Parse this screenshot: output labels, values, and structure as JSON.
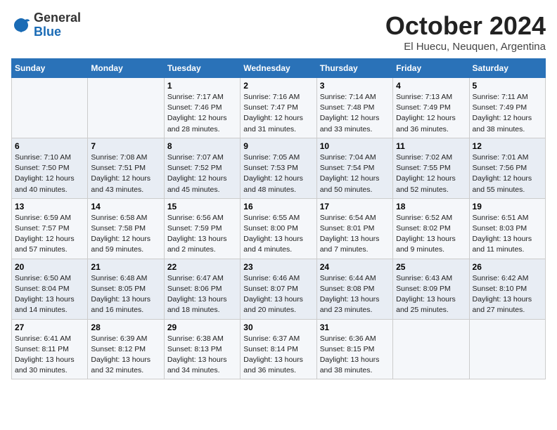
{
  "header": {
    "logo": {
      "general": "General",
      "blue": "Blue"
    },
    "title": "October 2024",
    "subtitle": "El Huecu, Neuquen, Argentina"
  },
  "days_of_week": [
    "Sunday",
    "Monday",
    "Tuesday",
    "Wednesday",
    "Thursday",
    "Friday",
    "Saturday"
  ],
  "weeks": [
    [
      {
        "day": "",
        "detail": ""
      },
      {
        "day": "",
        "detail": ""
      },
      {
        "day": "1",
        "detail": "Sunrise: 7:17 AM\nSunset: 7:46 PM\nDaylight: 12 hours\nand 28 minutes."
      },
      {
        "day": "2",
        "detail": "Sunrise: 7:16 AM\nSunset: 7:47 PM\nDaylight: 12 hours\nand 31 minutes."
      },
      {
        "day": "3",
        "detail": "Sunrise: 7:14 AM\nSunset: 7:48 PM\nDaylight: 12 hours\nand 33 minutes."
      },
      {
        "day": "4",
        "detail": "Sunrise: 7:13 AM\nSunset: 7:49 PM\nDaylight: 12 hours\nand 36 minutes."
      },
      {
        "day": "5",
        "detail": "Sunrise: 7:11 AM\nSunset: 7:49 PM\nDaylight: 12 hours\nand 38 minutes."
      }
    ],
    [
      {
        "day": "6",
        "detail": "Sunrise: 7:10 AM\nSunset: 7:50 PM\nDaylight: 12 hours\nand 40 minutes."
      },
      {
        "day": "7",
        "detail": "Sunrise: 7:08 AM\nSunset: 7:51 PM\nDaylight: 12 hours\nand 43 minutes."
      },
      {
        "day": "8",
        "detail": "Sunrise: 7:07 AM\nSunset: 7:52 PM\nDaylight: 12 hours\nand 45 minutes."
      },
      {
        "day": "9",
        "detail": "Sunrise: 7:05 AM\nSunset: 7:53 PM\nDaylight: 12 hours\nand 48 minutes."
      },
      {
        "day": "10",
        "detail": "Sunrise: 7:04 AM\nSunset: 7:54 PM\nDaylight: 12 hours\nand 50 minutes."
      },
      {
        "day": "11",
        "detail": "Sunrise: 7:02 AM\nSunset: 7:55 PM\nDaylight: 12 hours\nand 52 minutes."
      },
      {
        "day": "12",
        "detail": "Sunrise: 7:01 AM\nSunset: 7:56 PM\nDaylight: 12 hours\nand 55 minutes."
      }
    ],
    [
      {
        "day": "13",
        "detail": "Sunrise: 6:59 AM\nSunset: 7:57 PM\nDaylight: 12 hours\nand 57 minutes."
      },
      {
        "day": "14",
        "detail": "Sunrise: 6:58 AM\nSunset: 7:58 PM\nDaylight: 12 hours\nand 59 minutes."
      },
      {
        "day": "15",
        "detail": "Sunrise: 6:56 AM\nSunset: 7:59 PM\nDaylight: 13 hours\nand 2 minutes."
      },
      {
        "day": "16",
        "detail": "Sunrise: 6:55 AM\nSunset: 8:00 PM\nDaylight: 13 hours\nand 4 minutes."
      },
      {
        "day": "17",
        "detail": "Sunrise: 6:54 AM\nSunset: 8:01 PM\nDaylight: 13 hours\nand 7 minutes."
      },
      {
        "day": "18",
        "detail": "Sunrise: 6:52 AM\nSunset: 8:02 PM\nDaylight: 13 hours\nand 9 minutes."
      },
      {
        "day": "19",
        "detail": "Sunrise: 6:51 AM\nSunset: 8:03 PM\nDaylight: 13 hours\nand 11 minutes."
      }
    ],
    [
      {
        "day": "20",
        "detail": "Sunrise: 6:50 AM\nSunset: 8:04 PM\nDaylight: 13 hours\nand 14 minutes."
      },
      {
        "day": "21",
        "detail": "Sunrise: 6:48 AM\nSunset: 8:05 PM\nDaylight: 13 hours\nand 16 minutes."
      },
      {
        "day": "22",
        "detail": "Sunrise: 6:47 AM\nSunset: 8:06 PM\nDaylight: 13 hours\nand 18 minutes."
      },
      {
        "day": "23",
        "detail": "Sunrise: 6:46 AM\nSunset: 8:07 PM\nDaylight: 13 hours\nand 20 minutes."
      },
      {
        "day": "24",
        "detail": "Sunrise: 6:44 AM\nSunset: 8:08 PM\nDaylight: 13 hours\nand 23 minutes."
      },
      {
        "day": "25",
        "detail": "Sunrise: 6:43 AM\nSunset: 8:09 PM\nDaylight: 13 hours\nand 25 minutes."
      },
      {
        "day": "26",
        "detail": "Sunrise: 6:42 AM\nSunset: 8:10 PM\nDaylight: 13 hours\nand 27 minutes."
      }
    ],
    [
      {
        "day": "27",
        "detail": "Sunrise: 6:41 AM\nSunset: 8:11 PM\nDaylight: 13 hours\nand 30 minutes."
      },
      {
        "day": "28",
        "detail": "Sunrise: 6:39 AM\nSunset: 8:12 PM\nDaylight: 13 hours\nand 32 minutes."
      },
      {
        "day": "29",
        "detail": "Sunrise: 6:38 AM\nSunset: 8:13 PM\nDaylight: 13 hours\nand 34 minutes."
      },
      {
        "day": "30",
        "detail": "Sunrise: 6:37 AM\nSunset: 8:14 PM\nDaylight: 13 hours\nand 36 minutes."
      },
      {
        "day": "31",
        "detail": "Sunrise: 6:36 AM\nSunset: 8:15 PM\nDaylight: 13 hours\nand 38 minutes."
      },
      {
        "day": "",
        "detail": ""
      },
      {
        "day": "",
        "detail": ""
      }
    ]
  ]
}
